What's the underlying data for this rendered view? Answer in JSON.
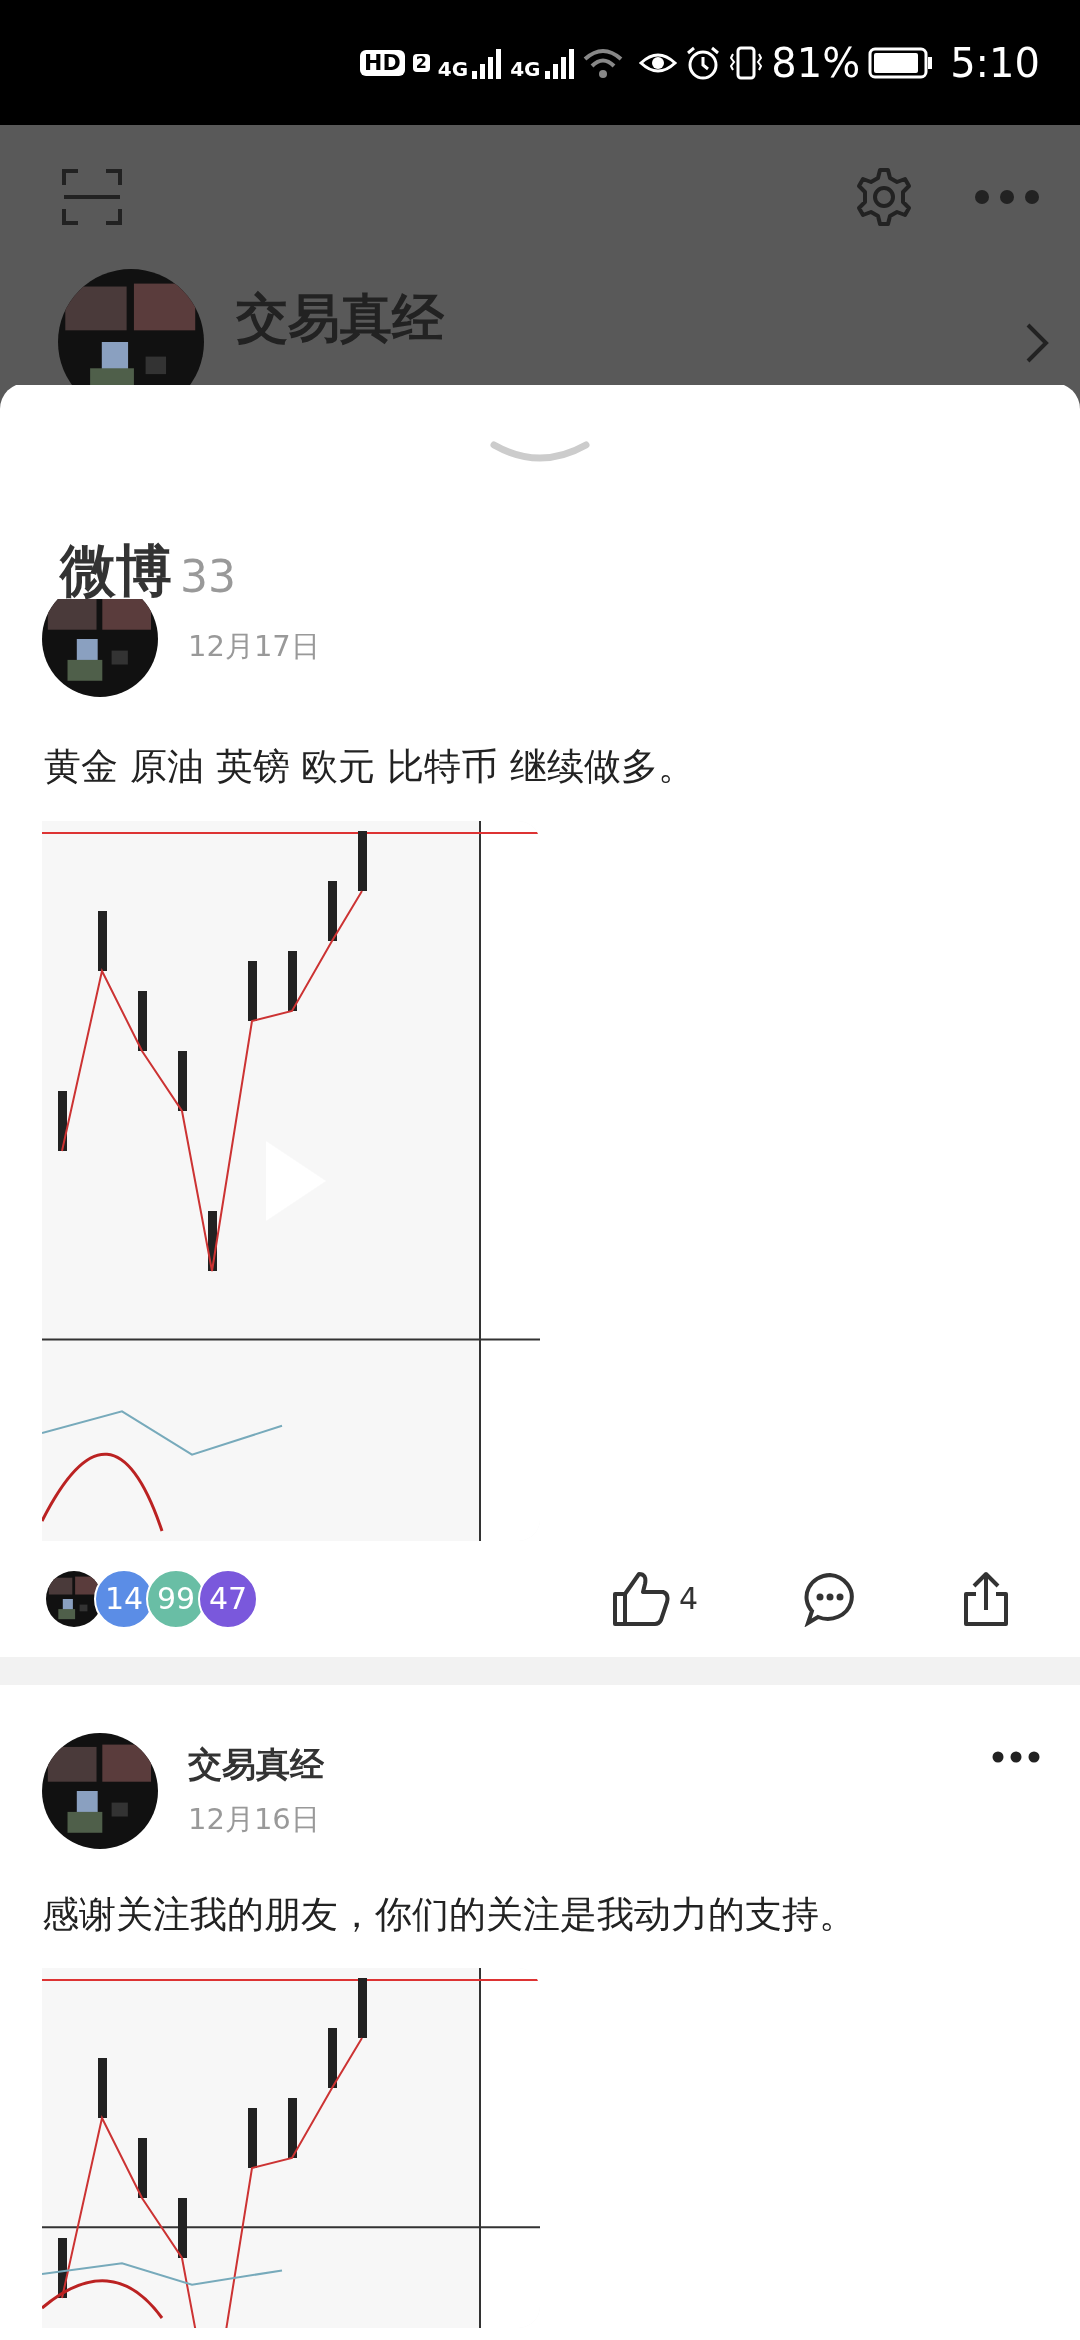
{
  "status_bar": {
    "hd_label": "HD",
    "sim_label": "2",
    "network_labels": [
      "4G",
      "4G"
    ],
    "battery": "81%",
    "time": "5:10"
  },
  "profile_header": {
    "name": "交易真经"
  },
  "section": {
    "title": "微博",
    "count": "33"
  },
  "posts": [
    {
      "date": "12月17日",
      "text": "黄金 原油 英镑 欧元 比特币 继续做多。",
      "media": {
        "kind": "picture",
        "video": true
      },
      "likers": [
        {
          "label": "14",
          "color": "#5b8de6"
        },
        {
          "label": "99",
          "color": "#69bea5"
        },
        {
          "label": "47",
          "color": "#7a58dc"
        }
      ],
      "like_count": "4"
    },
    {
      "author": "交易真经",
      "date": "12月16日",
      "text": "感谢关注我的朋友，你们的关注是我动力的支持。",
      "media": {
        "kind": "picture",
        "video": false
      }
    }
  ]
}
